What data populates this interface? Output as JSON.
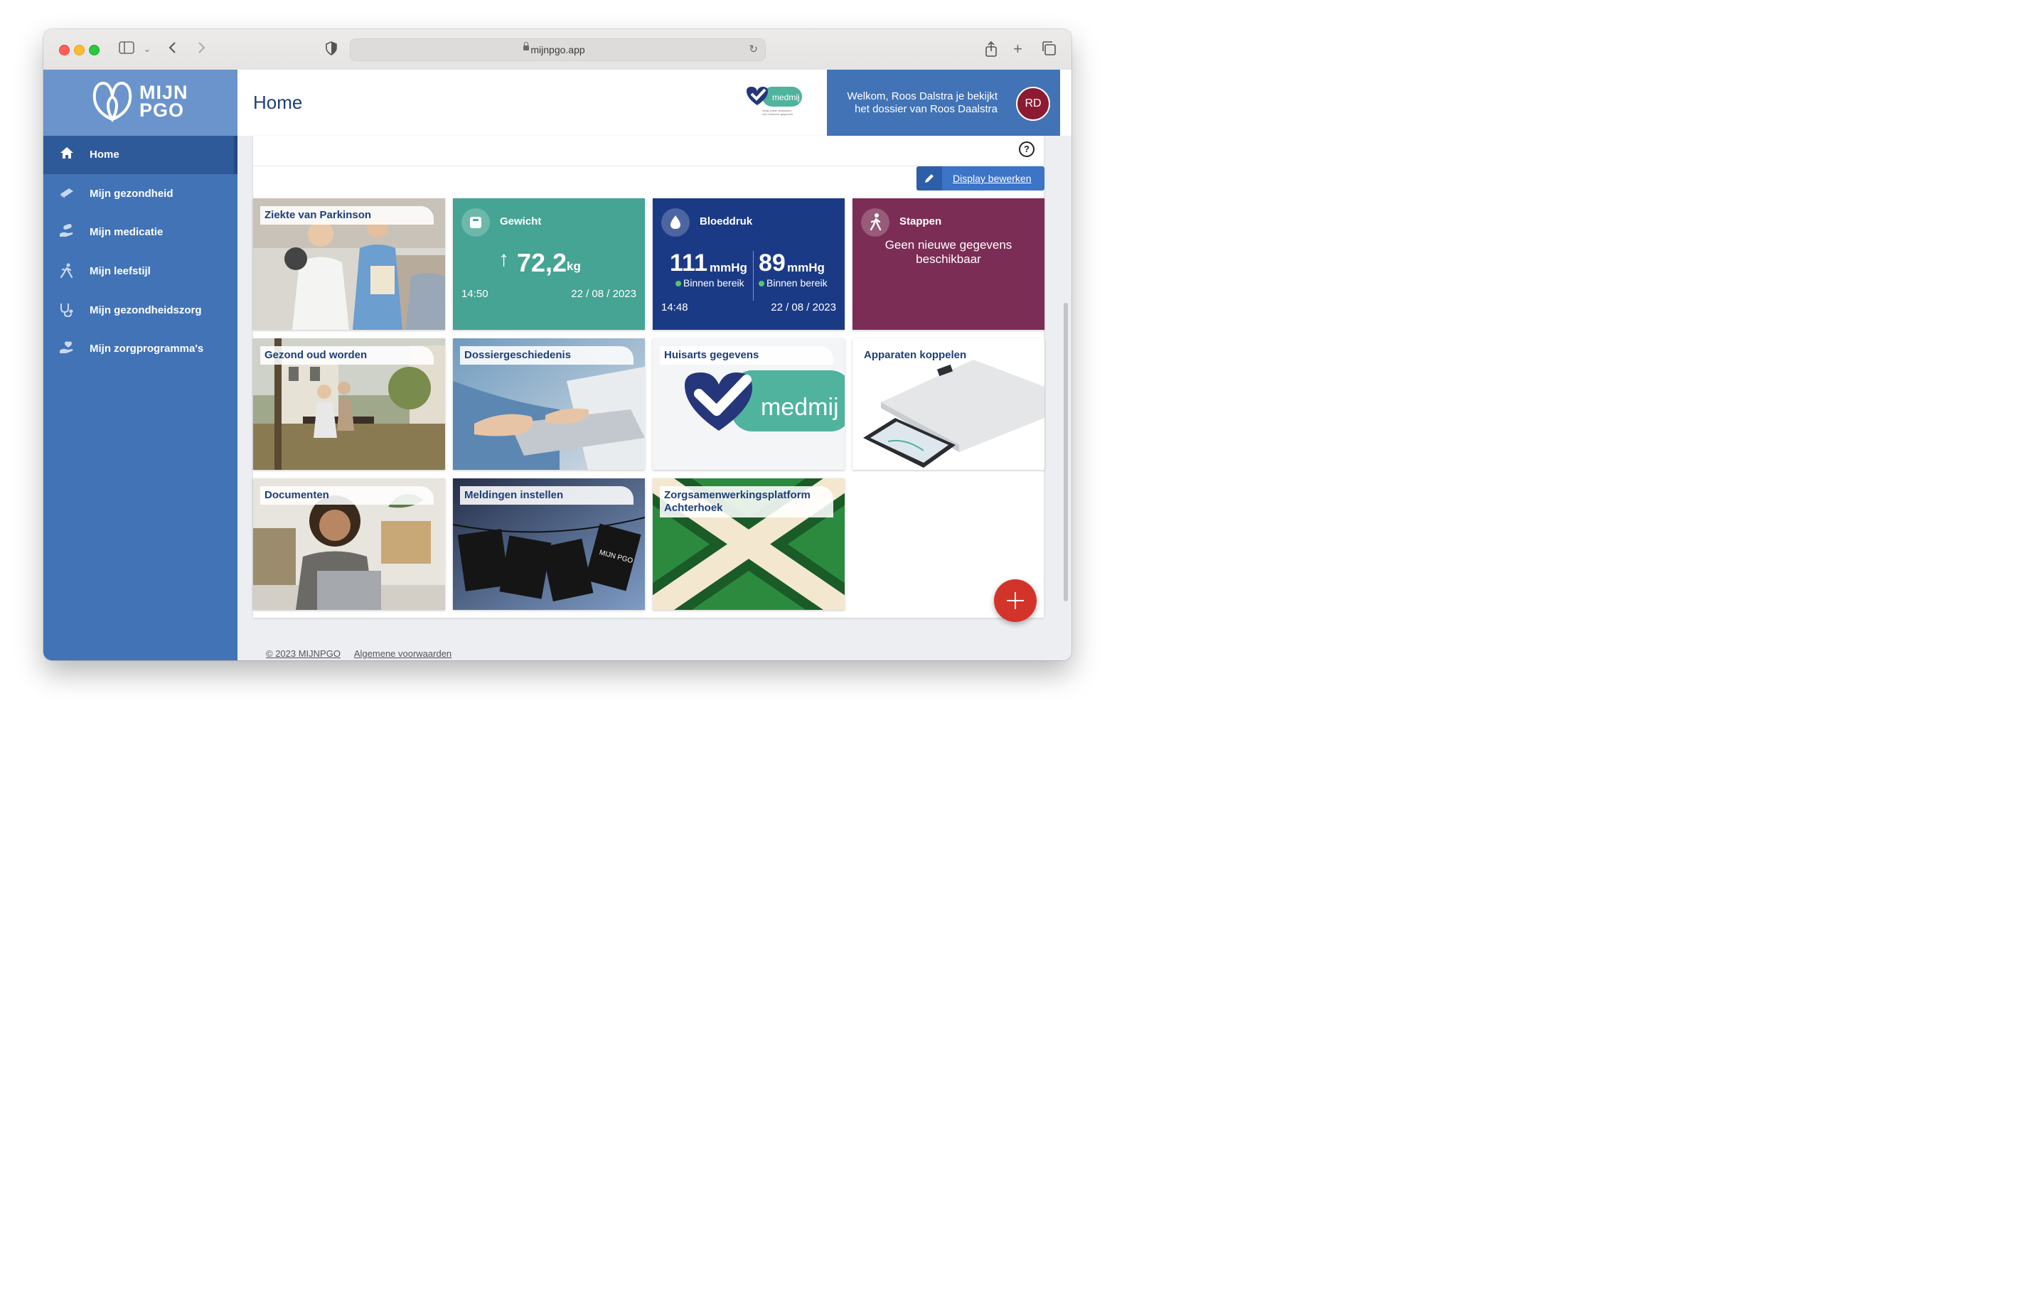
{
  "browser": {
    "url": "mijnpgo.app"
  },
  "brand": {
    "line1": "MIJN",
    "line2": "PGO"
  },
  "sidebar": {
    "items": [
      {
        "label": "Home",
        "icon": "home-icon",
        "active": true
      },
      {
        "label": "Mijn gezondheid",
        "icon": "book-icon"
      },
      {
        "label": "Mijn medicatie",
        "icon": "pill-hand-icon"
      },
      {
        "label": "Mijn leefstijl",
        "icon": "runner-icon"
      },
      {
        "label": "Mijn gezondheidszorg",
        "icon": "stethoscope-icon"
      },
      {
        "label": "Mijn zorgprogramma's",
        "icon": "care-hand-icon"
      }
    ]
  },
  "header": {
    "title": "Home",
    "medmij_logo_text": "medmij",
    "medmij_tagline": "veilig online uitwisselen van medische gegevens",
    "welcome_line1": "Welkom, Roos Dalstra je bekijkt",
    "welcome_line2": "het dossier van Roos Daalstra",
    "avatar_initials": "RD"
  },
  "toolbar": {
    "help_symbol": "?",
    "edit_label": "Display bewerken"
  },
  "tiles": {
    "parkinson": {
      "label": "Ziekte van Parkinson"
    },
    "gewicht": {
      "title": "Gewicht",
      "arrow": "↑",
      "value": "72,2",
      "unit": "kg",
      "time": "14:50",
      "date": "22 / 08 / 2023",
      "color": "#46a494"
    },
    "bloeddruk": {
      "title": "Bloeddruk",
      "systolic": "111",
      "diastolic": "89",
      "unit": "mmHg",
      "status": "Binnen bereik",
      "time": "14:48",
      "date": "22 / 08 / 2023",
      "color": "#1b3a86",
      "status_color": "#53c66b"
    },
    "stappen": {
      "title": "Stappen",
      "message": "Geen nieuwe gegevens beschikbaar",
      "color": "#7b2d55"
    },
    "gezond_oud": {
      "label": "Gezond oud worden"
    },
    "dossier": {
      "label": "Dossiergeschiedenis"
    },
    "huisarts": {
      "label": "Huisarts gegevens",
      "logo_text": "medmij"
    },
    "apparaten": {
      "label": "Apparaten koppelen"
    },
    "documenten": {
      "label": "Documenten"
    },
    "meldingen": {
      "label": "Meldingen instellen",
      "card_logo": "MIJN PGO"
    },
    "zorgsamenwerking": {
      "label": "Zorgsamenwerkingsplatform Achterhoek"
    }
  },
  "footer": {
    "copyright": "© 2023 MIJNPGO",
    "terms": "Algemene voorwaarden"
  }
}
